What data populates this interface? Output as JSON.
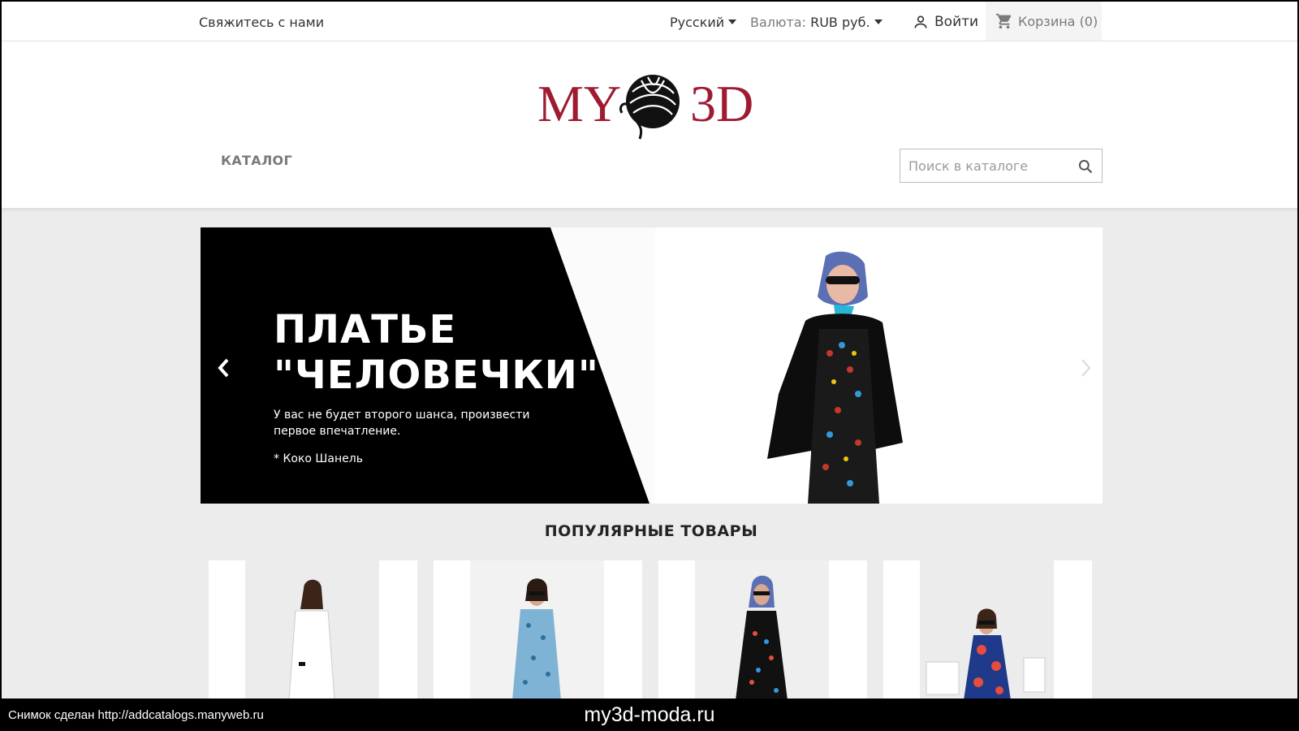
{
  "topbar": {
    "contact": "Свяжитесь с нами",
    "language": "Русский",
    "currency_label": "Валюта:",
    "currency_value": "RUB руб.",
    "login": "Войти",
    "cart": "Корзина (0)"
  },
  "header": {
    "logo_text_left": "MY",
    "logo_text_right": "3D",
    "catalog": "КАТАЛОГ",
    "search_placeholder": "Поиск в каталоге"
  },
  "slider": {
    "title": "ПЛАТЬЕ\n\"ЧЕЛОВЕЧКИ\"",
    "text": "У вас не будет второго шанса, произвести первое впечатление.",
    "quote": "* Коко Шанель"
  },
  "popular": {
    "title": "ПОПУЛЯРНЫЕ ТОВАРЫ"
  },
  "footer": {
    "snapshot": "Снимок сделан http://addcatalogs.manyweb.ru",
    "domain": "my3d-moda.ru"
  },
  "colors": {
    "brand": "#9e1b32",
    "banner_black": "#000000"
  }
}
